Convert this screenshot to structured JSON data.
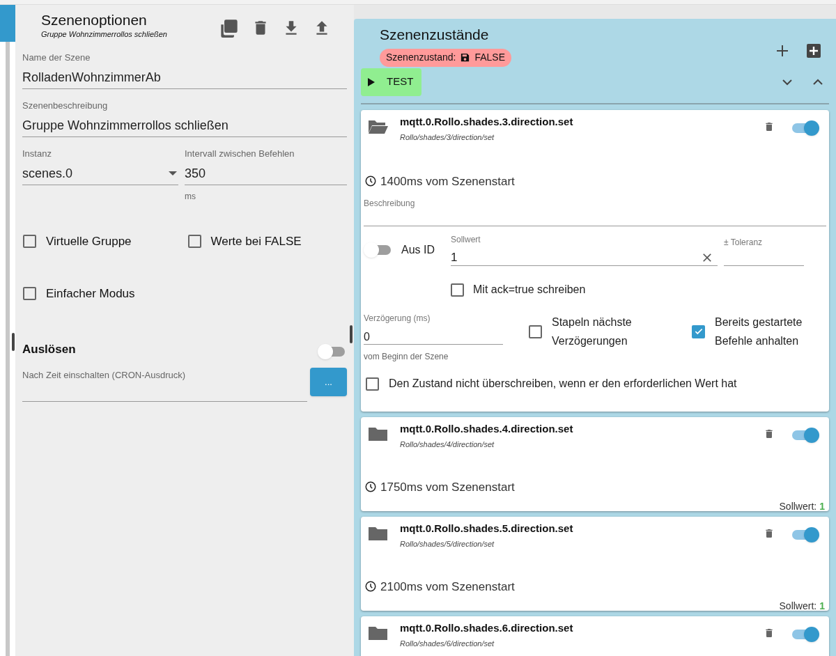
{
  "options": {
    "title": "Szenenoptionen",
    "subtitle": "Gruppe Wohnzimmerrollos schließen",
    "name_field": {
      "label": "Name der Szene",
      "value": "RolladenWohnzimmerAb"
    },
    "description_field": {
      "label": "Szenenbeschreibung",
      "value": "Gruppe Wohnzimmerrollos schließen"
    },
    "instance_field": {
      "label": "Instanz",
      "value": "scenes.0"
    },
    "interval_field": {
      "label": "Intervall zwischen Befehlen",
      "value": "350",
      "helper": "ms"
    },
    "checkboxes": [
      {
        "label": "Virtuelle Gruppe",
        "checked": false
      },
      {
        "label": "Werte bei FALSE",
        "checked": false
      },
      {
        "label": "Einfacher Modus",
        "checked": false
      }
    ],
    "trigger": {
      "title": "Auslösen",
      "on": false
    },
    "cron_field": {
      "label": "Nach Zeit einschalten (CRON-Ausdruck)"
    },
    "cron_button": "..."
  },
  "states": {
    "title": "Szenenzustände",
    "state_badge": {
      "label": "Szenenzustand:",
      "value": "FALSE"
    },
    "test_button": "TEST",
    "items": [
      {
        "kind": "expanded",
        "id": "mqtt.0.Rollo.shades.3.direction.set",
        "path": "Rollo/shades/3/direction/set",
        "enabled": true,
        "time": "1400ms vom Szenenstart",
        "description_label": "Beschreibung",
        "from_id": {
          "label": "Aus ID",
          "on": false
        },
        "setpoint": {
          "label": "Sollwert",
          "value": "1"
        },
        "tolerance": {
          "label": "± Toleranz"
        },
        "ack": {
          "label": "Mit ack=true schreiben",
          "checked": false
        },
        "delay": {
          "label": "Verzögerung (ms)",
          "value": "0",
          "helper": "vom Beginn der Szene"
        },
        "stack": {
          "label": "Stapeln nächste Verzögerungen",
          "checked": false
        },
        "stop": {
          "label": "Bereits gestartete Befehle anhalten",
          "checked": true
        },
        "dont_overwrite": {
          "label": "Den Zustand nicht überschreiben, wenn er den erforderlichen Wert hat",
          "checked": false
        }
      },
      {
        "kind": "collapsed",
        "id": "mqtt.0.Rollo.shades.4.direction.set",
        "path": "Rollo/shades/4/direction/set",
        "enabled": true,
        "time": "1750ms vom Szenenstart",
        "setpoint_label": "Sollwert:",
        "setpoint_value": "1"
      },
      {
        "kind": "collapsed",
        "id": "mqtt.0.Rollo.shades.5.direction.set",
        "path": "Rollo/shades/5/direction/set",
        "enabled": true,
        "time": "2100ms vom Szenenstart",
        "setpoint_label": "Sollwert:",
        "setpoint_value": "1"
      },
      {
        "kind": "collapsed",
        "id": "mqtt.0.Rollo.shades.6.direction.set",
        "path": "Rollo/shades/6/direction/set",
        "enabled": true
      }
    ]
  }
}
